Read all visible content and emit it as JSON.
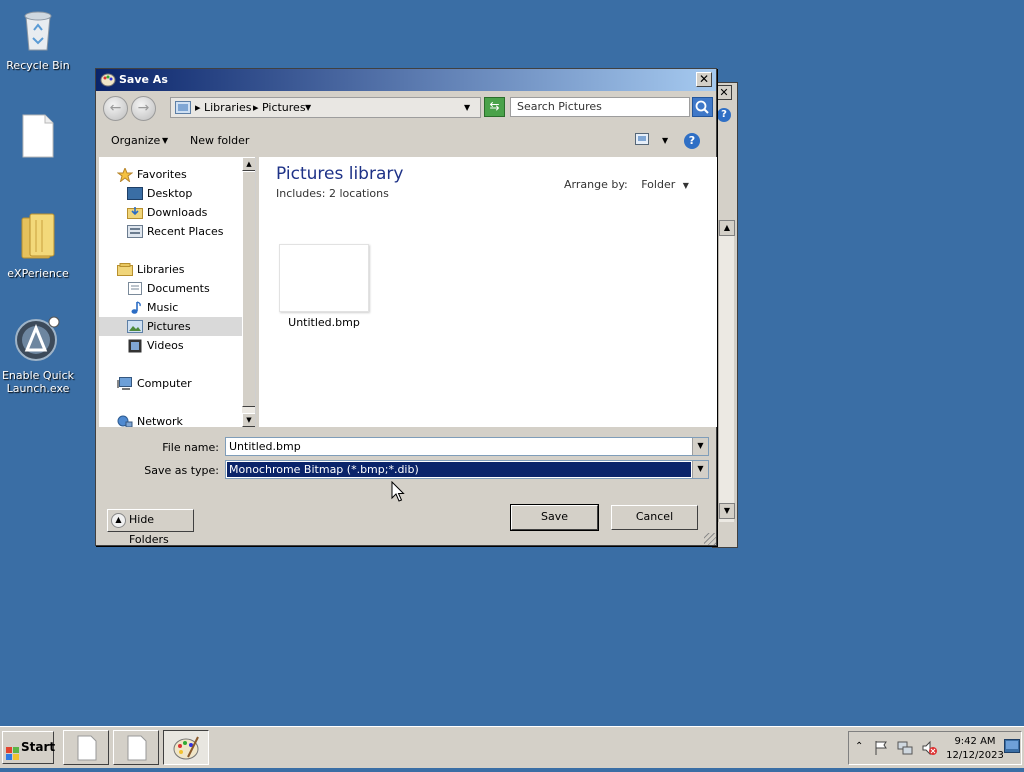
{
  "desktop": {
    "icons": [
      {
        "label": "Recycle Bin",
        "icon": "recycle-bin-icon"
      },
      {
        "label": "",
        "icon": "blank-document-icon"
      },
      {
        "label": "eXPerience",
        "icon": "folder-icon"
      },
      {
        "label": "Enable Quick Launch.exe",
        "icon": "quick-launch-icon"
      }
    ]
  },
  "dialog": {
    "title": "Save As",
    "close_label": "✕",
    "address": {
      "segments": [
        "Libraries",
        "Pictures"
      ]
    },
    "search": {
      "placeholder": "Search Pictures"
    },
    "toolbar": {
      "organize": "Organize",
      "new_folder": "New folder"
    },
    "nav": {
      "favorites": "Favorites",
      "desktop": "Desktop",
      "downloads": "Downloads",
      "recent_places": "Recent Places",
      "libraries": "Libraries",
      "documents": "Documents",
      "music": "Music",
      "pictures": "Pictures",
      "videos": "Videos",
      "computer": "Computer",
      "network": "Network"
    },
    "content": {
      "title": "Pictures library",
      "includes_label": "Includes:",
      "includes_value": "2 locations",
      "arrange_label": "Arrange by:",
      "arrange_value": "Folder",
      "files": [
        {
          "name": "Untitled.bmp"
        }
      ]
    },
    "form": {
      "file_name_label": "File name:",
      "file_name_value": "Untitled.bmp",
      "save_type_label": "Save as type:",
      "save_type_value": "Monochrome Bitmap (*.bmp;*.dib)"
    },
    "hide_folders": "Hide Folders",
    "save": "Save",
    "cancel": "Cancel"
  },
  "taskbar": {
    "start": "Start",
    "time": "9:42 AM",
    "date": "12/12/2023"
  },
  "colors": {
    "desktop": "#3a6ea5",
    "title_start": "#0a246a",
    "title_end": "#a6caf0",
    "selection": "#0a246a"
  }
}
